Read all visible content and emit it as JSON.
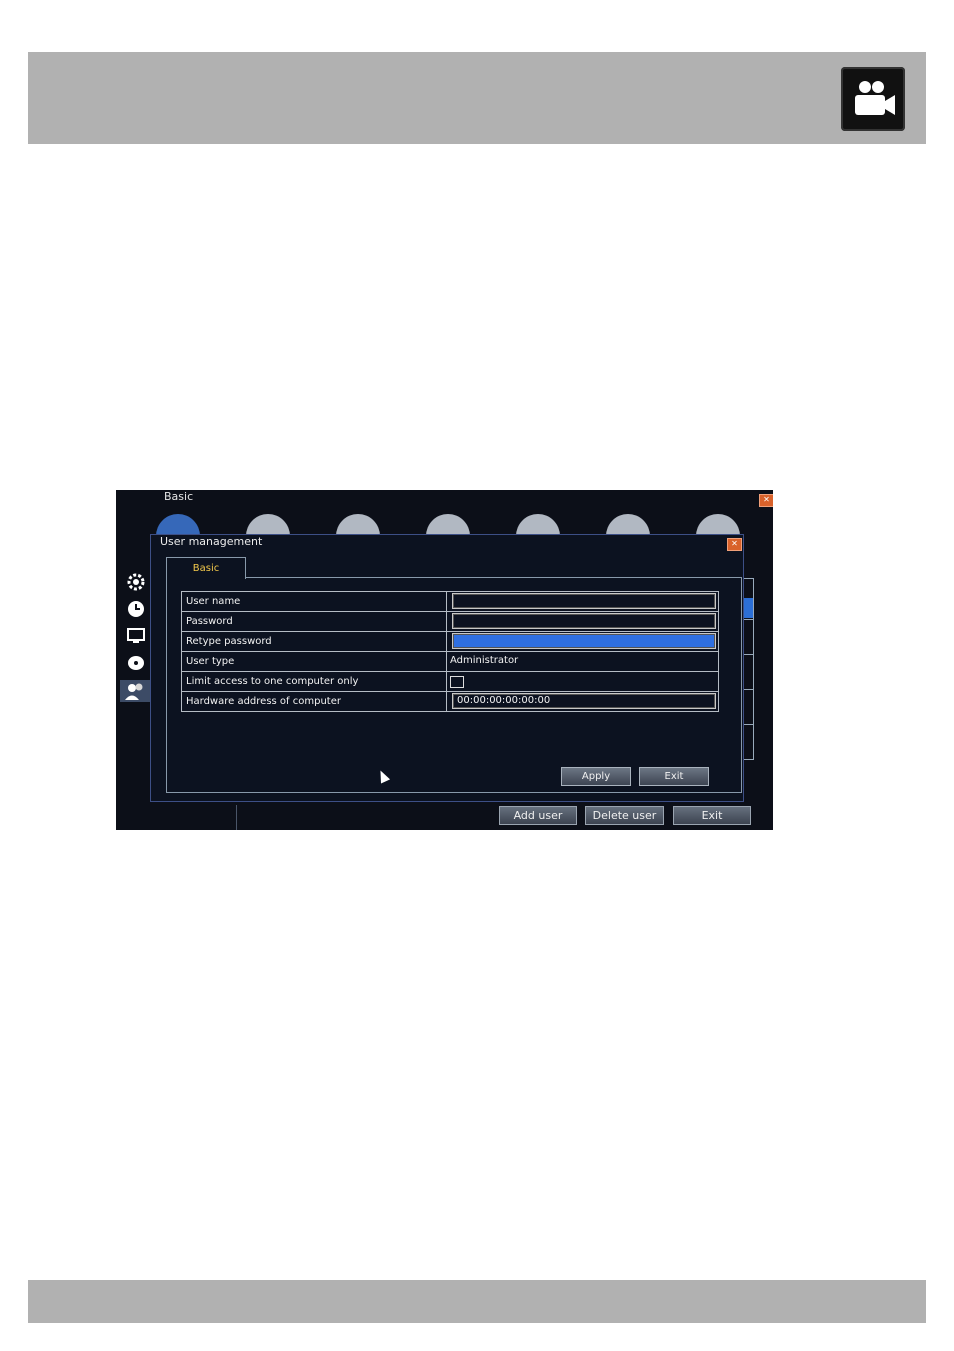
{
  "outer_window": {
    "title": "Basic",
    "buttons": {
      "add_user": "Add user",
      "delete_user": "Delete user",
      "exit": "Exit"
    }
  },
  "dialog": {
    "title": "User management",
    "tab": "Basic",
    "fields": {
      "user_name": {
        "label": "User name",
        "value": ""
      },
      "password": {
        "label": "Password",
        "value": ""
      },
      "retype_password": {
        "label": "Retype password",
        "value": ""
      },
      "user_type": {
        "label": "User type",
        "value": "Administrator"
      },
      "limit_access": {
        "label": "Limit access to one computer only",
        "checked": false
      },
      "hardware_address": {
        "label": "Hardware address of computer",
        "value": "00:00:00:00:00:00"
      }
    },
    "buttons": {
      "apply": "Apply",
      "exit": "Exit"
    }
  },
  "icons": {
    "header": "video-camera-icon",
    "side": [
      "gear-icon",
      "clock-icon",
      "monitor-icon",
      "disk-icon",
      "users-icon"
    ]
  },
  "colors": {
    "tab_text": "#f2c84b",
    "focus_field": "#2f6fe0",
    "close_button": "#d9622b"
  }
}
